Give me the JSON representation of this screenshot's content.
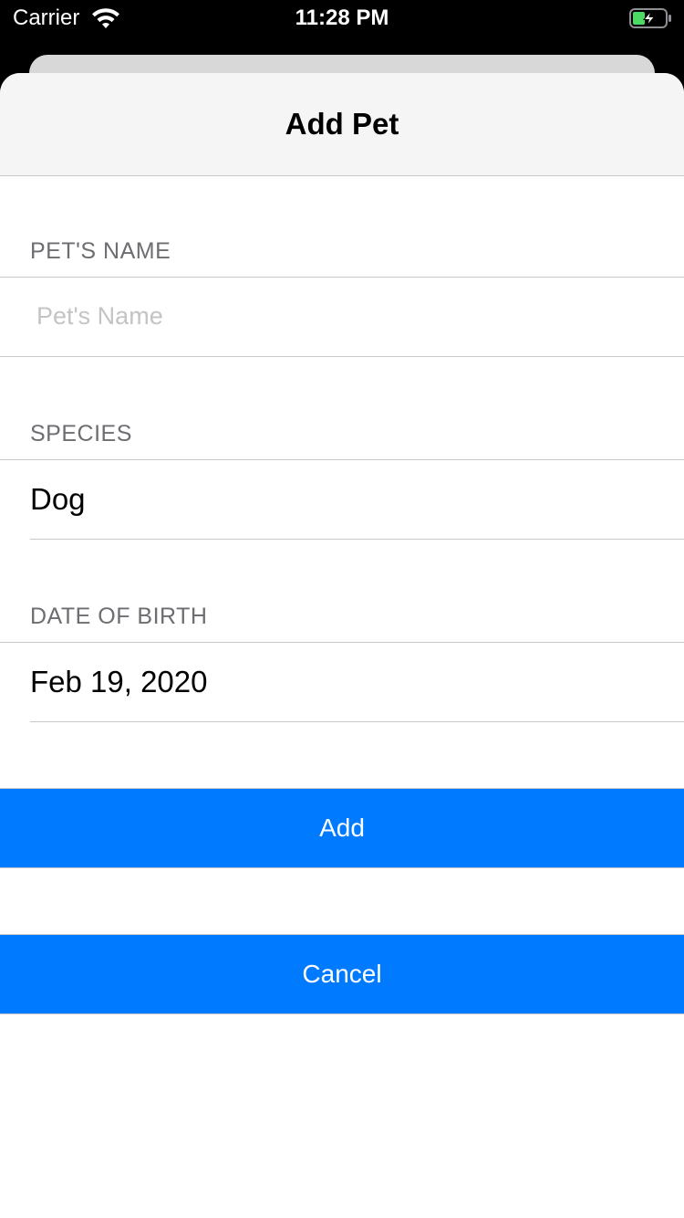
{
  "status_bar": {
    "carrier": "Carrier",
    "time": "11:28 PM",
    "wifi_icon": "wifi-icon",
    "battery_icon": "battery-charging-icon",
    "battery_color": "#4cd964"
  },
  "nav": {
    "title": "Add Pet"
  },
  "form": {
    "name_section": {
      "header": "PET'S NAME",
      "value": "",
      "placeholder": "Pet's Name"
    },
    "species_section": {
      "header": "SPECIES",
      "value": "Dog"
    },
    "dob_section": {
      "header": "DATE OF BIRTH",
      "value": "Feb 19, 2020"
    }
  },
  "actions": {
    "add_label": "Add",
    "cancel_label": "Cancel"
  },
  "colors": {
    "accent": "#007aff",
    "nav_background": "#f6f5f5",
    "section_header_text": "#6d6d72",
    "separator": "#c8c7cc"
  }
}
